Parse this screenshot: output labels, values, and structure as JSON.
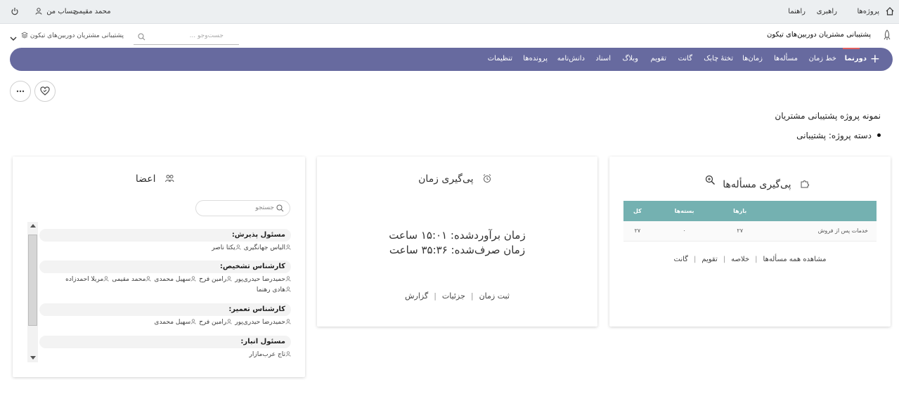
{
  "topbar": {
    "home_icon": "home-icon",
    "projects": "پروژه‌ها",
    "admin": "راهبری",
    "help": "راهنما",
    "user_name": "محمد مقیمی",
    "account": "حساب من",
    "power_icon": "power-icon"
  },
  "project": {
    "title": "پشتیبانی مشتریان دوربین‌های تیکون",
    "search_placeholder": "جست‌وجو ...",
    "selector_label": "پشتیبانی مشتریان دوربین‌های تیکون"
  },
  "nav": {
    "plus": "+",
    "items": [
      "دورنما",
      "خط زمان",
      "مسأله‌ها",
      "زمان‌ها",
      "تختهٔ چابک",
      "گانت",
      "تقویم",
      "وبلاگ",
      "اسناد",
      "دانش‌نامه",
      "پرونده‌ها",
      "تنظیمات"
    ],
    "active_color": "#e06060",
    "bar_color": "#676a9f"
  },
  "overview": {
    "description": "نمونه پروژه پشتیبانی مشتریان",
    "category": "دسته پروژه: پشتیبانی"
  },
  "issues": {
    "title": "پی‌گیری مسأله‌ها",
    "headers": [
      "",
      "بازها",
      "بسته‌ها",
      "کل"
    ],
    "rows": [
      {
        "name": "خدمات پس از فروش",
        "open": "۲۷",
        "closed": "۰",
        "total": "۲۷"
      }
    ],
    "links": [
      "مشاهده همه مسأله‌ها",
      "خلاصه",
      "تقویم",
      "گانت"
    ],
    "header_color": "#74b1b1"
  },
  "time": {
    "title": "پی‌گیری زمان",
    "estimated": "زمان برآوردشده: ۱۵:۰۱ ساعت",
    "spent": "زمان صرف‌شده: ۳۵:۳۶ ساعت",
    "links": [
      "ثبت زمان",
      "جزئیات",
      "گزارش"
    ]
  },
  "members": {
    "title": "اعضا",
    "search_placeholder": "جستجو",
    "roles": [
      {
        "name": "مسئول پذیرش:",
        "people": [
          "الیاس جهانگیری",
          "یکتا ناصر"
        ]
      },
      {
        "name": "کارشناس تشخیص:",
        "people": [
          "حمیدرضا حیدری‌پور",
          "رامین فرح",
          "سهیل محمدی",
          "محمد مقیمی",
          "مریلا احمدزاده",
          "هادی رهنما"
        ]
      },
      {
        "name": "کارشناس تعمیر:",
        "people": [
          "حمیدرضا حیدری‌پور",
          "رامین فرح",
          "سهیل محمدی"
        ]
      },
      {
        "name": "مسئول انبار:",
        "people": [
          "تاج عرب‌مازار"
        ]
      }
    ]
  }
}
